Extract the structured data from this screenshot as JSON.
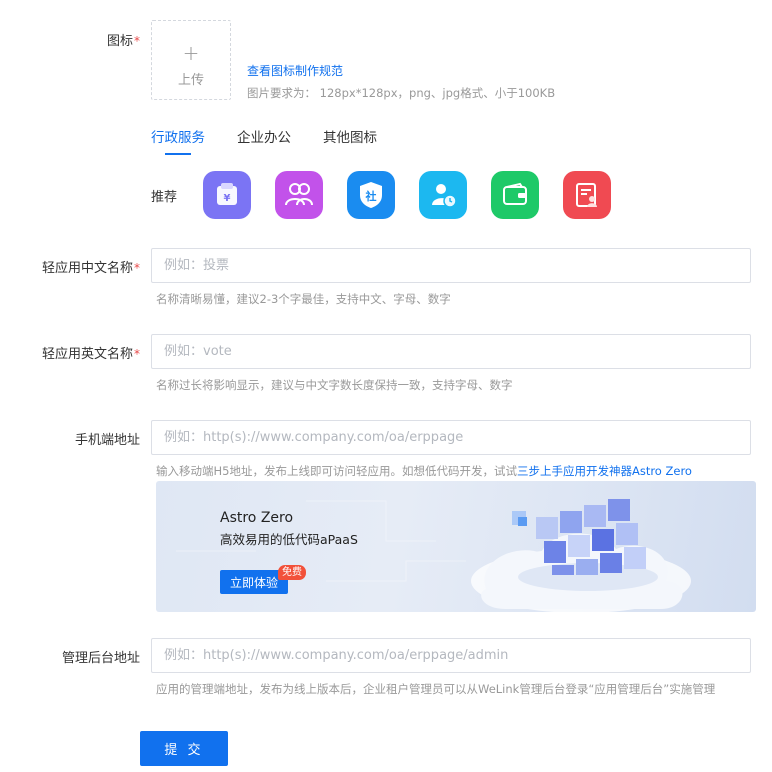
{
  "icon_field": {
    "label": "图标",
    "required_mark": "*",
    "upload_plus": "+",
    "upload_label": "上传",
    "spec_link": "查看图标制作规范",
    "requirement": "图片要求为： 128px*128px，png、jpg格式、小于100KB"
  },
  "icon_tabs": [
    {
      "label": "行政服务",
      "active": true
    },
    {
      "label": "企业办公",
      "active": false
    },
    {
      "label": "其他图标",
      "active": false
    }
  ],
  "recommend": {
    "label": "推荐",
    "icons": [
      {
        "name": "wallet-yen-icon",
        "color": "#7b74f4"
      },
      {
        "name": "users-icon",
        "color": "#c252ea"
      },
      {
        "name": "social-shield-icon",
        "color": "#1a8cf0"
      },
      {
        "name": "user-clock-icon",
        "color": "#1cb8f0"
      },
      {
        "name": "wallet-icon",
        "color": "#1ec968"
      },
      {
        "name": "user-document-icon",
        "color": "#f04a52"
      }
    ]
  },
  "cn_name": {
    "label": "轻应用中文名称",
    "required_mark": "*",
    "placeholder": "例如：投票",
    "hint": "名称清晰易懂，建议2-3个字最佳，支持中文、字母、数字"
  },
  "en_name": {
    "label": "轻应用英文名称",
    "required_mark": "*",
    "placeholder": "例如：vote",
    "hint": "名称过长将影响显示，建议与中文字数长度保持一致，支持字母、数字"
  },
  "mobile_url": {
    "label": "手机端地址",
    "placeholder": "例如：http(s)://www.company.com/oa/erppage",
    "hint": "输入移动端H5地址，发布上线即可访问轻应用。如想低代码开发，试试",
    "hint_link": "三步上手应用开发神器Astro Zero"
  },
  "banner": {
    "title": "Astro Zero",
    "subtitle": "高效易用的低代码aPaaS",
    "button": "立即体验",
    "badge": "免费"
  },
  "admin_url": {
    "label": "管理后台地址",
    "placeholder": "例如：http(s)://www.company.com/oa/erppage/admin",
    "hint": "应用的管理端地址，发布为线上版本后，企业租户管理员可以从WeLink管理后台登录“应用管理后台”实施管理"
  },
  "submit_label": "提 交",
  "colors": {
    "primary": "#1171ee",
    "required": "#e84a4a",
    "hint_text": "#999999",
    "badge": "#f2513a"
  }
}
